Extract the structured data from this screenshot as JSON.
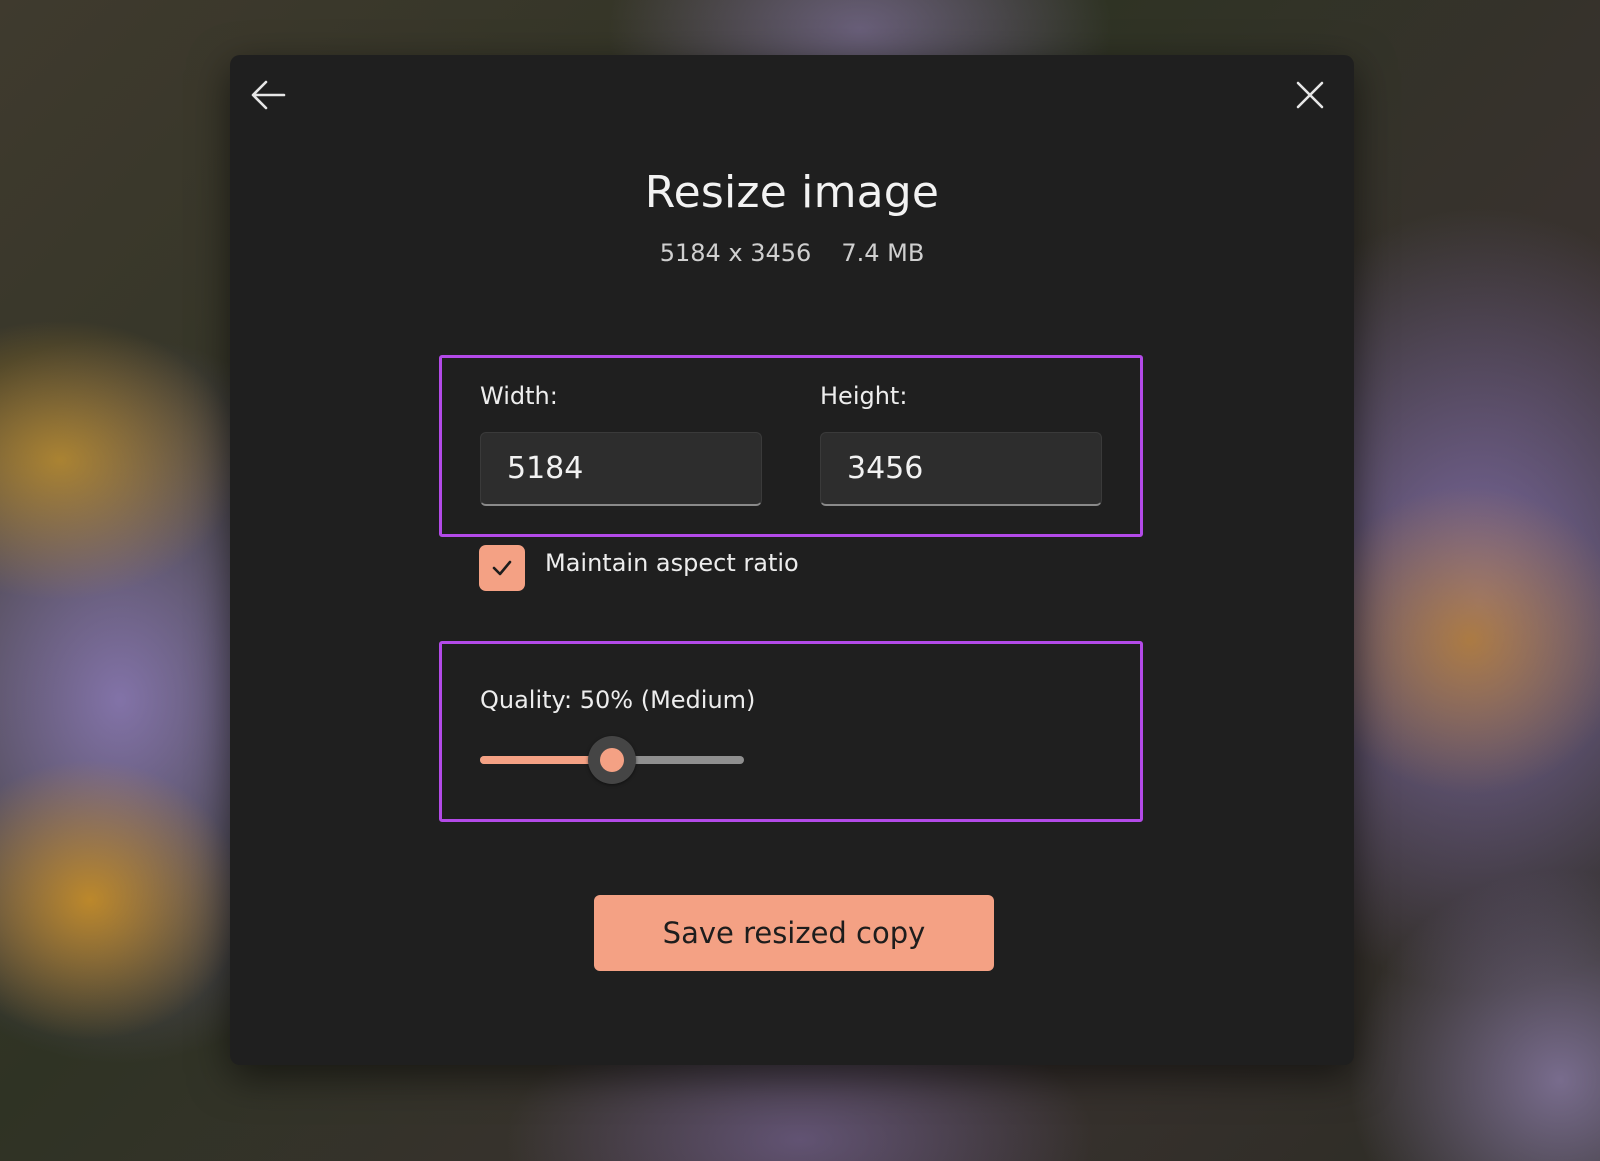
{
  "dialog": {
    "title": "Resize image",
    "dimensions": "5184 x 3456",
    "file_size": "7.4 MB"
  },
  "icons": {
    "back": "arrow-left-icon",
    "close": "close-icon",
    "checkmark": "checkmark-icon"
  },
  "fields": {
    "width_label": "Width:",
    "width_value": "5184",
    "height_label": "Height:",
    "height_value": "3456"
  },
  "aspect_ratio": {
    "label": "Maintain aspect ratio",
    "checked": true
  },
  "quality": {
    "label": "Quality: 50% (Medium)",
    "value_percent": 50
  },
  "save_button": {
    "label": "Save resized copy"
  },
  "colors": {
    "accent": "#f4a184",
    "highlight_border": "#b34ae8",
    "dialog_background": "#1f1f1f"
  }
}
